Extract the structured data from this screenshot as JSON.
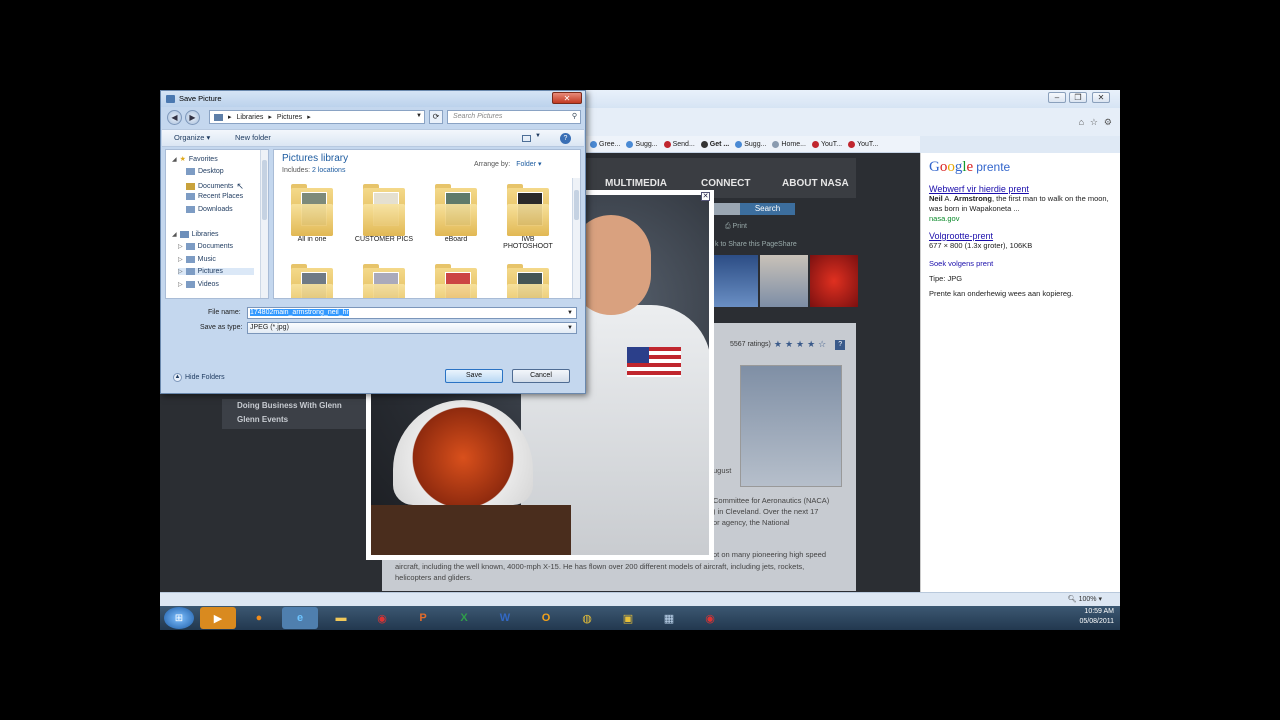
{
  "dialog": {
    "title": "Save Picture",
    "breadcrumb": [
      "Libraries",
      "Pictures"
    ],
    "search_placeholder": "Search Pictures",
    "toolbar": {
      "organize": "Organize ▾",
      "new_folder": "New folder"
    },
    "nav": {
      "favorites": "Favorites",
      "favorites_items": [
        "Desktop",
        "Documents",
        "Recent Places",
        "Downloads"
      ],
      "libraries": "Libraries",
      "libraries_items": [
        "Documents",
        "Music",
        "Pictures",
        "Videos"
      ]
    },
    "library_title": "Pictures library",
    "includes_label": "Includes:",
    "includes_link": "2 locations",
    "arrange_label": "Arrange by:",
    "arrange_value": "Folder ▾",
    "folders": [
      "All in one",
      "CUSTOMER PICS",
      "eBoard",
      "IWB PHOTOSHOOT"
    ],
    "file_name_label": "File name:",
    "file_name_value": "174802main_armstrong_neil_hr",
    "save_type_label": "Save as type:",
    "save_type_value": "JPEG (*.jpg)",
    "hide_folders": "Hide Folders",
    "save_button": "Save",
    "cancel_button": "Cancel"
  },
  "browser": {
    "favorites": [
      "Gree...",
      "Sugg...",
      "Send...",
      "Get ...",
      "Sugg...",
      "Home...",
      "YouT...",
      "YouT..."
    ]
  },
  "nasa": {
    "nav": [
      "MULTIMEDIA",
      "CONNECT",
      "ABOUT NASA"
    ],
    "search_button": "Search",
    "print": "Print",
    "share": "k to Share this PageShare",
    "rating": "5567 ratings)",
    "side_links": [
      "Doing Business With Glenn",
      "Glenn Events"
    ],
    "text_august": "ugust",
    "text_lines": [
      "Committee for Aeronautics (NACA)",
      ") in Cleveland. Over the next 17",
      "or agency, the National"
    ],
    "text_bottom": [
      "aircraft, including the well known, 4000-mph X-15. He has flown over 200 different models of aircraft, including jets, rockets,",
      "helicopters and gliders."
    ],
    "text_pilot": "ot on many pioneering high speed"
  },
  "google": {
    "logo_suffix": "prente",
    "link1": "Webwerf vir hierdie prent",
    "desc1_bold1": "Neil",
    "desc1_a": " A. ",
    "desc1_bold2": "Armstrong",
    "desc1_b": ", the first man to walk on the moon, was born in Wapakoneta ...",
    "source": "nasa.gov",
    "link2": "Volgrootte-prent",
    "size": "677 × 800 (1.3x groter), 106KB",
    "similar": "Soek volgens prent",
    "type": "Tipe:  JPG",
    "copyright": "Prente kan onderhewig wees aan kopiereg."
  },
  "statusbar": {
    "zoom": "100%"
  },
  "taskbar": {
    "time": "10:59 AM",
    "date": "05/08/2011"
  },
  "colors": {
    "taskbar": "#22384f",
    "dialog": "#c4d7ee",
    "google_link": "#1a0dab"
  }
}
